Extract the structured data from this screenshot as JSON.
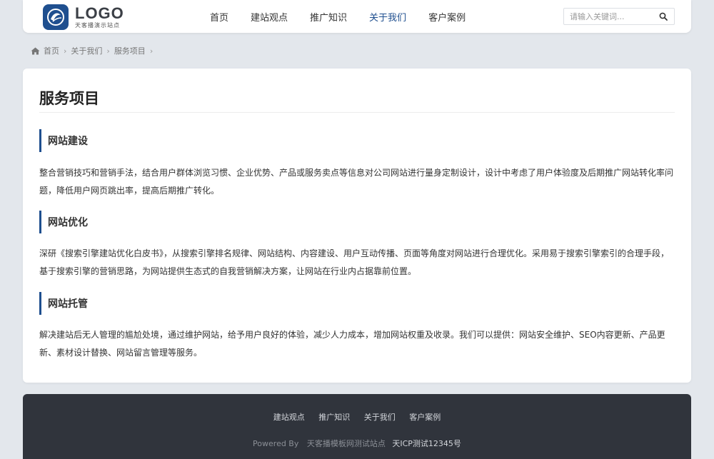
{
  "header": {
    "logo_word": "LOGO",
    "logo_sub": "天客播演示站点",
    "nav": [
      {
        "label": "首页"
      },
      {
        "label": "建站观点"
      },
      {
        "label": "推广知识"
      },
      {
        "label": "关于我们"
      },
      {
        "label": "客户案例"
      }
    ],
    "active_nav_index": 3,
    "search": {
      "placeholder": "请输入关键词..."
    }
  },
  "breadcrumb": {
    "items": [
      "首页",
      "关于我们",
      "服务项目"
    ],
    "separator": "›"
  },
  "main": {
    "title": "服务项目",
    "sections": [
      {
        "heading": "网站建设",
        "body": "整合营销技巧和营销手法，结合用户群体浏览习惯、企业优势、产品或服务卖点等信息对公司网站进行量身定制设计，设计中考虑了用户体验度及后期推广网站转化率问题，降低用户网页跳出率，提高后期推广转化。"
      },
      {
        "heading": "网站优化",
        "body": "深研《搜索引擎建站优化白皮书》，从搜索引擎排名规律、网站结构、内容建设、用户互动传播、页面等角度对网站进行合理优化。采用易于搜索引擎索引的合理手段，基于搜索引擎的营销思路，为网站提供生态式的自我营销解决方案，让网站在行业内占据靠前位置。"
      },
      {
        "heading": "网站托管",
        "body": "解决建站后无人管理的尴尬处境，通过维护网站，给予用户良好的体验，减少人力成本，增加网站权重及收录。我们可以提供：网站安全维护、SEO内容更新、产品更新、素材设计替换、网站留言管理等服务。"
      }
    ]
  },
  "footer": {
    "links": [
      "建站观点",
      "推广知识",
      "关于我们",
      "客户案例"
    ],
    "powered_by": "Powered By",
    "site_name": "天客播模板网测试站点",
    "icp": "天ICP测试12345号"
  },
  "colors": {
    "accent": "#1f4f8f",
    "page_bg": "#e3e7ec",
    "footer_bg": "#30343c"
  },
  "icons": {
    "logo": "logo-mark-icon",
    "search": "search-icon",
    "home": "home-icon"
  }
}
